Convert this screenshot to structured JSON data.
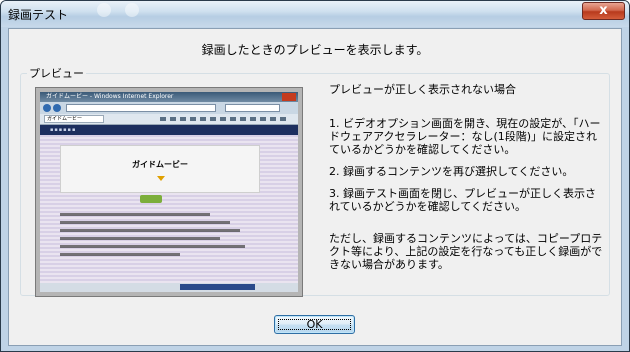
{
  "window": {
    "title": "録画テスト",
    "close_symbol": "x"
  },
  "heading": "録画したときのプレビューを表示します。",
  "preview_group": {
    "legend": "プレビュー",
    "thumbnail": {
      "browser_title": "ガイドムービー - Windows Internet Explorer",
      "tab_label": "ガイドムービー",
      "page_heading": "ガイドムービー"
    }
  },
  "help": {
    "title": "プレビューが正しく表示されない場合",
    "paragraphs": [
      "1. ビデオオプション画面を開き、現在の設定が、「ハードウェアアクセラレーター：なし(1段階)」に設定されているかどうかを確認してください。",
      "2. 録画するコンテンツを再び選択してください。",
      "3. 録画テスト画面を閉じ、プレビューが正しく表示されているかどうかを確認してください。",
      "ただし、録画するコンテンツによっては、コピープロテクト等により、上記の設定を行なっても正しく録画ができない場合があります。"
    ]
  },
  "ok_button": "OK"
}
